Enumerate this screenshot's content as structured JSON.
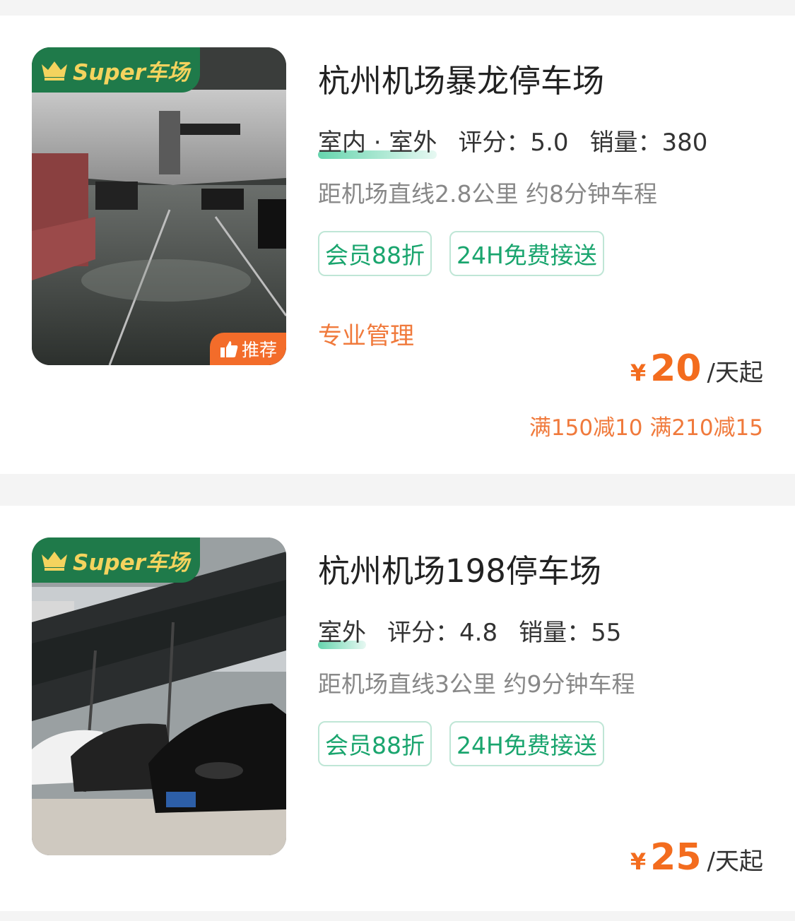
{
  "badges": {
    "super_brand": "Super车场",
    "recommend": "推荐"
  },
  "colors": {
    "brand_green": "#1f7a4a",
    "badge_gold": "#f4d35e",
    "price_orange": "#f36c1e",
    "tag_green": "#1aa56e",
    "recommend_orange": "#f36c2a"
  },
  "lots": [
    {
      "name": "杭州机场暴龙停车场",
      "type": "室内 · 室外",
      "rating": "评分：5.0",
      "sales": "销量：380",
      "distance": "距机场直线2.8公里 约8分钟车程",
      "tags": [
        "会员88折",
        "24H免费接送"
      ],
      "feature": "专业管理",
      "price_symbol": "¥",
      "price": "20",
      "price_unit": "/天起",
      "promo": "满150减10 满210减15",
      "photo": "underground-garage"
    },
    {
      "name": "杭州机场198停车场",
      "type": "室外",
      "rating": "评分：4.8",
      "sales": "销量：55",
      "distance": "距机场直线3公里 约9分钟车程",
      "tags": [
        "会员88折",
        "24H免费接送"
      ],
      "price_symbol": "¥",
      "price": "25",
      "price_unit": "/天起",
      "photo": "outdoor-lot-with-cars"
    }
  ]
}
